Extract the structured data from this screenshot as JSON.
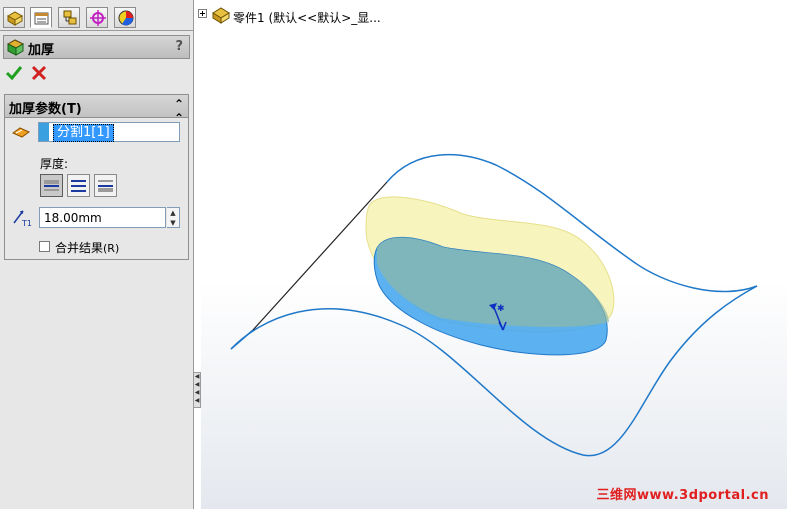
{
  "panel": {
    "tabs": [
      {
        "name": "featuremanager",
        "icon": "feature-tree-icon"
      },
      {
        "name": "propertymanager",
        "icon": "property-manager-icon"
      },
      {
        "name": "configurationmanager",
        "icon": "configuration-icon"
      },
      {
        "name": "dimxpertmanager",
        "icon": "dimxpert-icon"
      },
      {
        "name": "displaymanager",
        "icon": "display-manager-icon"
      }
    ],
    "title": "加厚",
    "help": "?",
    "ok_icon": "check-icon",
    "cancel_icon": "close-icon"
  },
  "parameters": {
    "group_title": "加厚参数(T)",
    "collapse_icon": "double-chevron-up-icon",
    "selection_item": "分割1[1]",
    "thickness_label": "厚度:",
    "side_buttons": [
      "side1",
      "both-sides",
      "side2"
    ],
    "distance_value": "18.00mm",
    "merge_label": "合并结果",
    "merge_shortcut": "(R)",
    "merge_checked": false
  },
  "tree": {
    "item_text": "零件1  (默认<<默认>_显..."
  },
  "colors": {
    "accent": "#3399ff",
    "surface_edge": "#1f78c8",
    "patch_blue": "#4aa8f0",
    "patch_yellow": "#f5f0a8"
  },
  "watermark": "三维网www.3dportal.cn"
}
